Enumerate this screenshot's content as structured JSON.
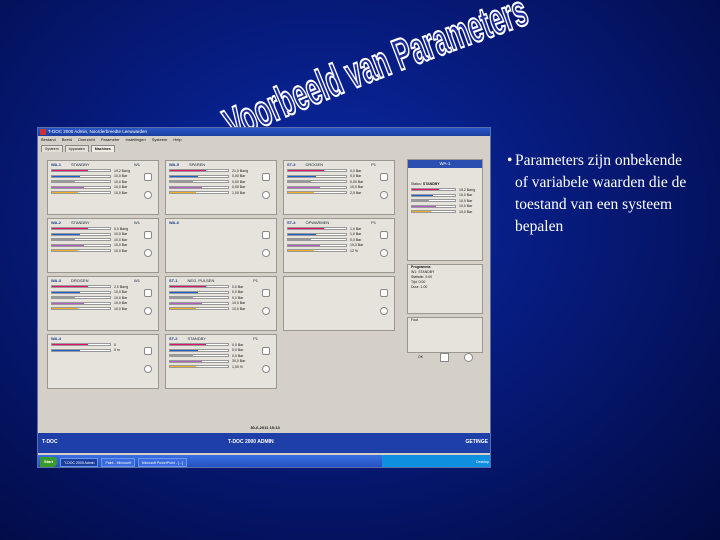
{
  "slide": {
    "title": "Voorbeeld van Parameters",
    "bullet": "Parameters zijn onbekende of variabele waarden die de toestand van een systeem bepalen"
  },
  "app": {
    "window_title": "T-DOC 2000 Admin, Noorderbreedte Leeuwarden",
    "menu": [
      "Bestand",
      "Beeld",
      "Overzicht",
      "Parameter",
      "Instellingen",
      "Systeem",
      "Help"
    ],
    "tabs": [
      "Systeem",
      "Apparaten",
      "Machines"
    ],
    "panels": [
      {
        "name": "WA-1",
        "state": "STANDBY",
        "prog": "W1",
        "values": [
          "19,2 Bar/g",
          "10,0 Bar",
          "10,0 Bar",
          "10,0 Bar",
          "10,0 Bar"
        ]
      },
      {
        "name": "WA-5",
        "state": "SPAREN",
        "prog": "",
        "values": [
          "21,0 Bar/g",
          "0,00 Bar",
          "0,00 Bar",
          "0,00 Bar",
          "1,00 Bar"
        ]
      },
      {
        "name": "ST-3",
        "state": "DROGEN",
        "prog": "P1",
        "values": [
          "0,0 Bar",
          "0,0 Bar",
          "0,00 Bar",
          "10,0 Bar",
          "2,5 Bar"
        ]
      },
      {
        "name": "WA-2",
        "state": "STANDBY",
        "prog": "W1",
        "values": [
          "0,0 Bar/g",
          "10,0 Bar",
          "10,0 Bar",
          "10,0 Bar",
          "10,0 Bar"
        ]
      },
      {
        "name": "WA-6",
        "state": "",
        "prog": "",
        "values": []
      },
      {
        "name": "ST-4",
        "state": "OPWARMEN",
        "prog": "P1",
        "values": [
          "1,0 Bar",
          "1,0 Bar",
          "0,0 Bar",
          "10,0 Bar",
          "12 %"
        ]
      },
      {
        "name": "WA-3",
        "state": "DROGEN",
        "prog": "W1",
        "values": [
          "2,0 Bar/g",
          "10,0 Bar",
          "10,0 Bar",
          "10,0 Bar",
          "10,0 Bar"
        ]
      },
      {
        "name": "ST-1",
        "state": "NEG. PULSEN",
        "prog": "P1",
        "values": [
          "0,0 Bar",
          "0,0 Bar",
          "0,0 Bar",
          "10,0 Bar",
          "10,0 Bar"
        ]
      },
      {
        "name": "",
        "state": "",
        "prog": "",
        "values": []
      },
      {
        "name": "WA-4",
        "state": "",
        "prog": "",
        "values": [
          "0",
          "0 m"
        ]
      },
      {
        "name": "ST-2",
        "state": "STANDBY",
        "prog": "P1",
        "values": [
          "0,0 Bar",
          "0,0 Bar",
          "0,0 Bar",
          "30,0 Bar",
          "1,00 %"
        ]
      }
    ],
    "side": {
      "header": "WA-1",
      "status_label": "Status",
      "status_value": "STANDBY",
      "program_label": "Programma",
      "lines": [
        "W1: STANDBY",
        "Statistic: 0:00",
        "Tijd: 0:00",
        "Duur: 1:00"
      ],
      "field_label": "Fout"
    },
    "datetime": "30-6-2011 15:13",
    "footer_left": "T-DOC",
    "footer_center": "T-DOC 2000 ADMIN",
    "footer_right": "GETINGE",
    "taskbar": {
      "start": "Start",
      "items": [
        "T-DOC 2000 Admin",
        "Paint - Microsoft",
        "Microsoft PowerPoint - [...]"
      ],
      "tray": "Desktop"
    }
  },
  "colors": {
    "bar_colors": [
      "#e0106a",
      "#1a5fd0",
      "#9a9a9a",
      "#b060c0",
      "#f0b020"
    ]
  }
}
